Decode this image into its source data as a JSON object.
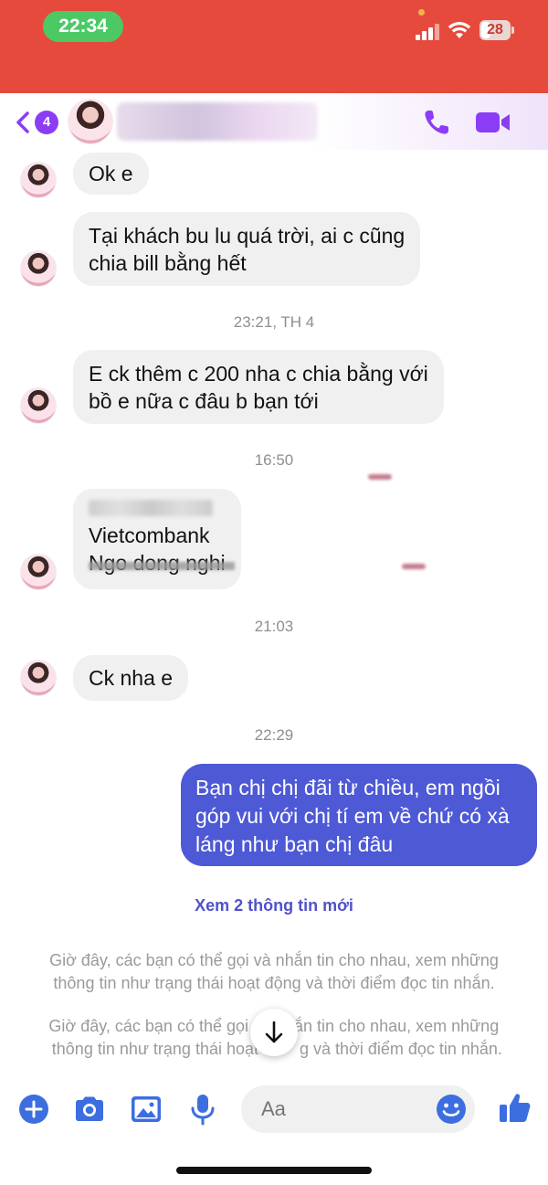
{
  "status_bar": {
    "time": "22:34",
    "battery": "28",
    "icons": [
      "signal-icon",
      "wifi-icon",
      "battery-icon"
    ],
    "background": "#e64a3c"
  },
  "header": {
    "back_badge": "4",
    "icons": [
      "back-chevron-icon",
      "phone-icon",
      "video-camera-icon"
    ],
    "accent": "#8b3df5"
  },
  "messages": [
    {
      "direction": "incoming",
      "lines": [
        "Ok e"
      ]
    },
    {
      "direction": "incoming",
      "lines": [
        "Tại khách bu lu quá trời, ai c cũng",
        "chia bill bằng hết"
      ]
    },
    {
      "type": "timestamp",
      "text": "23:21, TH 4"
    },
    {
      "direction": "incoming",
      "lines": [
        "E ck thêm c 200 nha c chia bằng với",
        "bồ e nữa c đâu b bạn tới"
      ]
    },
    {
      "type": "timestamp",
      "text": "16:50"
    },
    {
      "direction": "incoming",
      "lines": [
        "Vietcombank",
        "Ngo dong nghi"
      ]
    },
    {
      "type": "timestamp",
      "text": "21:03"
    },
    {
      "direction": "incoming",
      "lines": [
        "Ck nha e"
      ]
    },
    {
      "type": "timestamp",
      "text": "22:29"
    },
    {
      "direction": "outgoing",
      "lines": [
        "Bạn chị chị đãi từ chiều, em ngồi",
        "góp vui với chị tí em về chứ có xà",
        "láng như bạn chị đâu"
      ]
    }
  ],
  "see_more": "Xem 2 thông tin mới",
  "notices": [
    [
      "Giờ đây, các bạn có thể gọi và nhắn tin cho nhau, xem những",
      "thông tin như trạng thái hoạt động và thời điểm đọc tin nhắn."
    ],
    [
      "Giờ đây, các bạn có thể gọi",
      "ắn tin cho nhau, xem những",
      "thông tin như trạng thái hoạt",
      "g và thời điểm đọc tin nhắn."
    ]
  ],
  "composer": {
    "placeholder": "Aa",
    "icons": [
      "plus-icon",
      "camera-icon",
      "image-icon",
      "microphone-icon",
      "emoji-icon",
      "like-icon"
    ],
    "accent": "#3d6ee0"
  },
  "outgoing_bubble_color": "#4e59d6"
}
